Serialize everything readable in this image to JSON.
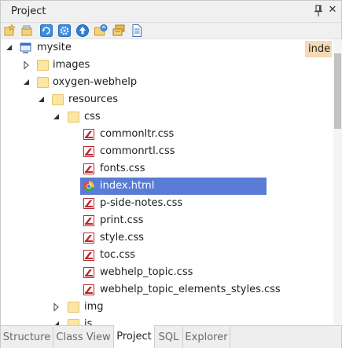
{
  "panel": {
    "title": "Project",
    "pin_icon": "pin-icon",
    "close_glyph": "✕"
  },
  "toolbar": {
    "buttons": [
      {
        "name": "add-project-button",
        "icon": "new-project-icon"
      },
      {
        "name": "link-folder-button",
        "icon": "link-icon"
      },
      {
        "name": "refresh-button",
        "icon": "refresh-icon"
      },
      {
        "name": "settings-button",
        "icon": "gear-icon"
      },
      {
        "name": "go-up-button",
        "icon": "up-arrow-icon"
      },
      {
        "name": "open-folder-button",
        "icon": "folder-open-icon"
      },
      {
        "name": "stack-button",
        "icon": "stack-icon"
      },
      {
        "name": "document-button",
        "icon": "document-icon"
      }
    ]
  },
  "search_hint": "inde",
  "tree": [
    {
      "label": "mysite",
      "type": "project",
      "expanded": true
    },
    {
      "label": "images",
      "type": "folder",
      "expanded": false
    },
    {
      "label": "oxygen-webhelp",
      "type": "folder",
      "expanded": true
    },
    {
      "label": "resources",
      "type": "folder",
      "expanded": true
    },
    {
      "label": "css",
      "type": "folder",
      "expanded": true
    },
    {
      "label": "commonltr.css",
      "type": "css"
    },
    {
      "label": "commonrtl.css",
      "type": "css"
    },
    {
      "label": "fonts.css",
      "type": "css"
    },
    {
      "label": "index.html",
      "type": "html",
      "selected": true
    },
    {
      "label": "p-side-notes.css",
      "type": "css"
    },
    {
      "label": "print.css",
      "type": "css"
    },
    {
      "label": "style.css",
      "type": "css"
    },
    {
      "label": "toc.css",
      "type": "css"
    },
    {
      "label": "webhelp_topic.css",
      "type": "css"
    },
    {
      "label": "webhelp_topic_elements_styles.css",
      "type": "css"
    },
    {
      "label": "img",
      "type": "folder",
      "expanded": false
    },
    {
      "label": "js",
      "type": "folder",
      "expanded": true
    }
  ],
  "tabs": [
    {
      "label": "Structure",
      "active": false
    },
    {
      "label": "Class View",
      "active": false
    },
    {
      "label": "Project",
      "active": true
    },
    {
      "label": "SQL",
      "active": false
    },
    {
      "label": "Explorer",
      "active": false
    }
  ],
  "colors": {
    "selection": "#5a7cd6",
    "search_hint_bg": "#f6d9b5",
    "folder": "#fbe6a2",
    "css_icon": "#c0272d"
  }
}
